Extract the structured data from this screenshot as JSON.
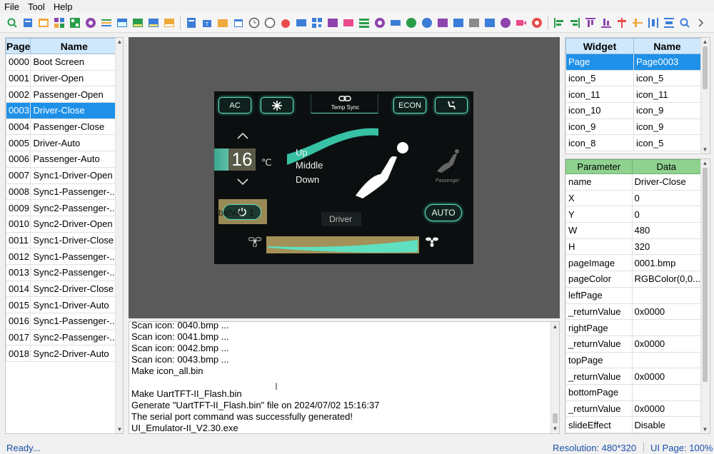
{
  "menu": [
    "File",
    "Tool",
    "Help"
  ],
  "pages": {
    "headers": [
      "Page",
      "Name"
    ],
    "rows": [
      [
        "0000",
        "Boot Screen"
      ],
      [
        "0001",
        "Driver-Open"
      ],
      [
        "0002",
        "Passenger-Open"
      ],
      [
        "0003",
        "Driver-Close"
      ],
      [
        "0004",
        "Passenger-Close"
      ],
      [
        "0005",
        "Driver-Auto"
      ],
      [
        "0006",
        "Passenger-Auto"
      ],
      [
        "0007",
        "Sync1-Driver-Open"
      ],
      [
        "0008",
        "Sync1-Passenger-..."
      ],
      [
        "0009",
        "Sync2-Passenger-..."
      ],
      [
        "0010",
        "Sync2-Driver-Open"
      ],
      [
        "0011",
        "Sync1-Driver-Close"
      ],
      [
        "0012",
        "Sync1-Passenger-..."
      ],
      [
        "0013",
        "Sync2-Passenger-..."
      ],
      [
        "0014",
        "Sync2-Driver-Close"
      ],
      [
        "0015",
        "Sync1-Driver-Auto"
      ],
      [
        "0016",
        "Sync1-Passenger-..."
      ],
      [
        "0017",
        "Sync2-Passenger-..."
      ],
      [
        "0018",
        "Sync2-Driver-Auto"
      ]
    ],
    "selected_index": 3
  },
  "device": {
    "ac": "AC",
    "temp_sync": "Temp Sync",
    "econ": "ECON",
    "temp": "16",
    "unit": "℃",
    "up": "Up",
    "middle": "Middle",
    "down": "Down",
    "passenger": "Passenger",
    "batvar": "batVar",
    "one": "1",
    "auto": "AUTO",
    "driver": "Driver"
  },
  "log_lines": [
    "Scan icon: 0040.bmp ...",
    "Scan icon: 0041.bmp ...",
    "Scan icon: 0042.bmp ...",
    "Scan icon: 0043.bmp ...",
    "Make icon_all.bin",
    "",
    "Make UartTFT-II_Flash.bin",
    "Generate \"UartTFT-II_Flash.bin\" file on 2024/07/02 15:16:37",
    "The serial port command was successfully generated!",
    "UI_Emulator-II_V2.30.exe"
  ],
  "widgets": {
    "headers": [
      "Widget",
      "Name"
    ],
    "rows": [
      [
        "Page",
        "Page0003"
      ],
      [
        "icon_5",
        "icon_5"
      ],
      [
        "icon_11",
        "icon_11"
      ],
      [
        "icon_10",
        "icon_9"
      ],
      [
        "icon_9",
        "icon_9"
      ],
      [
        "icon_8",
        "icon_5"
      ]
    ],
    "selected_index": 0
  },
  "params": {
    "headers": [
      "Parameter",
      "Data"
    ],
    "rows": [
      [
        "name",
        "Driver-Close"
      ],
      [
        "X",
        "0"
      ],
      [
        "Y",
        "0"
      ],
      [
        "W",
        "480"
      ],
      [
        "H",
        "320"
      ],
      [
        "pageImage",
        "0001.bmp"
      ],
      [
        "pageColor",
        "RGBColor(0,0..."
      ],
      [
        "leftPage",
        ""
      ],
      [
        "  _returnValue",
        "0x0000"
      ],
      [
        "rightPage",
        ""
      ],
      [
        "  _returnValue",
        "0x0000"
      ],
      [
        "topPage",
        ""
      ],
      [
        "  _returnValue",
        "0x0000"
      ],
      [
        "bottomPage",
        ""
      ],
      [
        "  _returnValue",
        "0x0000"
      ],
      [
        "slideEffect",
        "Disable"
      ]
    ]
  },
  "status": {
    "ready": "Ready...",
    "resolution": "Resolution: 480*320",
    "ui_page": "UI Page: 100%"
  },
  "colors": {
    "accent": "#1e90e8",
    "header_blue": "#cfe8fb",
    "header_green": "#8fd18f",
    "glow": "#5fe0c0"
  }
}
